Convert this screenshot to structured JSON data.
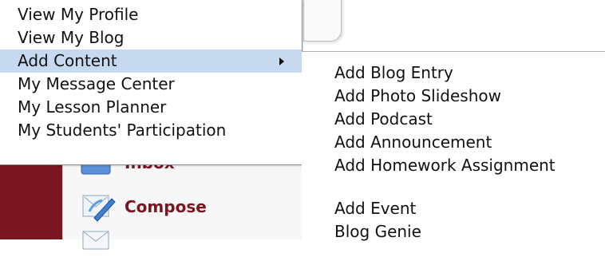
{
  "menu": {
    "items": [
      {
        "label": "View My Profile"
      },
      {
        "label": "View My Blog"
      },
      {
        "label": "Add Content"
      },
      {
        "label": "My Message Center"
      },
      {
        "label": "My Lesson Planner"
      },
      {
        "label": "My Students' Participation"
      }
    ],
    "selected_index": 2
  },
  "submenu": {
    "items": [
      {
        "label": "Add Blog Entry"
      },
      {
        "label": "Add Photo Slideshow"
      },
      {
        "label": "Add Podcast"
      },
      {
        "label": "Add Announcement"
      },
      {
        "label": "Add Homework Assignment"
      },
      {
        "label": "Add Event"
      },
      {
        "label": "Blog Genie"
      }
    ]
  },
  "background": {
    "inbox_label": "Inbox",
    "compose_label": "Compose"
  },
  "colors": {
    "maroon": "#7b1620",
    "highlight": "#c7d9ee"
  }
}
